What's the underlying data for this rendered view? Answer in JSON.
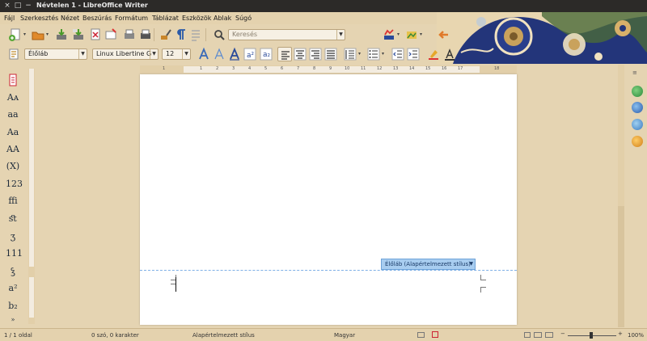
{
  "window": {
    "title": "Névtelen 1 - LibreOffice Writer",
    "close_glyph": "×",
    "maximize_glyph": "□",
    "minimize_glyph": "−"
  },
  "menu": {
    "items": [
      "Fájl",
      "Szerkesztés",
      "Nézet",
      "Beszúrás",
      "Formátum",
      "Táblázat",
      "Eszközök",
      "Ablak",
      "Súgó"
    ]
  },
  "toolbar": {
    "search_placeholder": "Keresés",
    "style_value": "Élőláb",
    "font_value": "Linux Libertine G",
    "size_value": "12"
  },
  "document": {
    "footer_label": "Élőláb (Alapértelmezett stílus)"
  },
  "sidebar_left": {
    "items": [
      "Aᴀ",
      "aa",
      "Aa",
      "AA",
      "(X)",
      "123",
      "ffi",
      "ﬆ",
      "ʒ",
      "111",
      "ꝣ",
      "a²",
      "b₂"
    ],
    "more_glyph": "»"
  },
  "statusbar": {
    "page": "1 / 1 oldal",
    "words": "0 szó, 0 karakter",
    "style": "Alapértelmezett stílus",
    "language": "Magyar",
    "zoom_minus": "−",
    "zoom_plus": "+",
    "zoom": "100%"
  },
  "ruler": {
    "labels": [
      "1",
      "1",
      "2",
      "3",
      "4",
      "5",
      "6",
      "7",
      "8",
      "9",
      "10",
      "11",
      "12",
      "13",
      "14",
      "15",
      "16",
      "17",
      "18"
    ]
  },
  "colors": {
    "chrome": "#e4d2ae",
    "titlebar": "#2c2a28",
    "footer_accent": "#a8cdf0"
  }
}
